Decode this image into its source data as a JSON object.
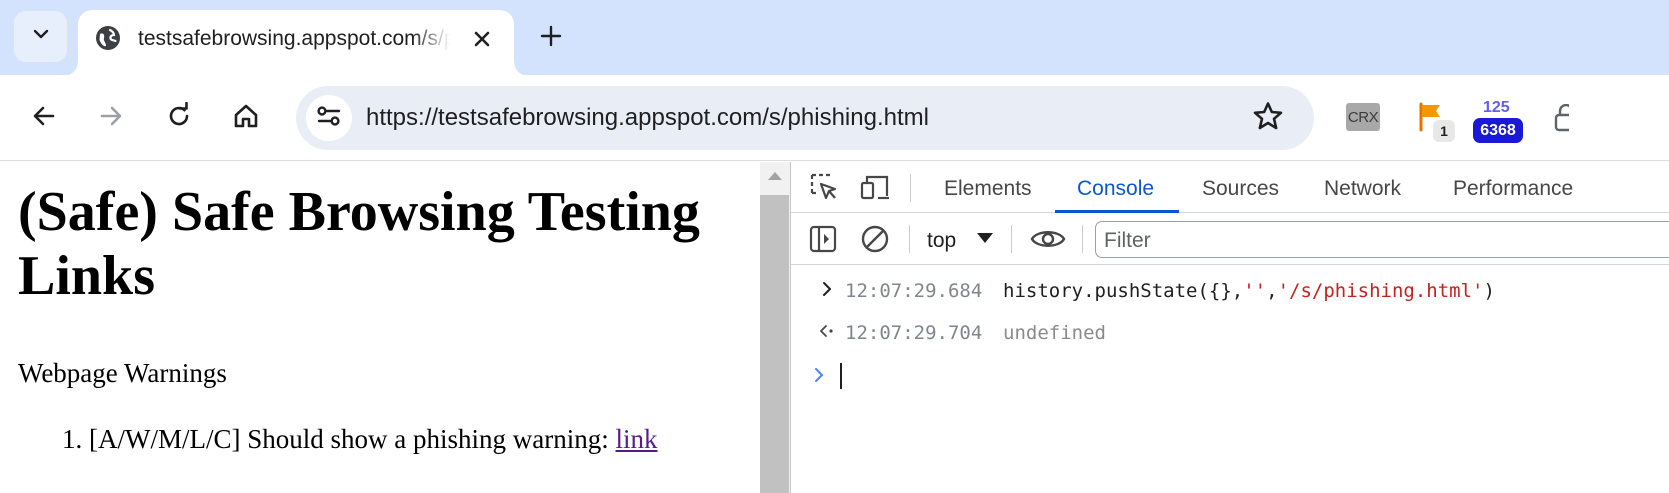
{
  "tab": {
    "title": "testsafebrowsing.appspot.com/s/phishing.html"
  },
  "toolbar": {
    "url": "https://testsafebrowsing.appspot.com/s/phishing.html"
  },
  "extensions": {
    "crx_label": "CRX",
    "flag_badge": "1",
    "counter_top": "125",
    "counter_badge": "6368"
  },
  "page": {
    "heading": "(Safe) Safe Browsing Testing Links",
    "section": "Webpage Warnings",
    "item_number": "1.",
    "item_text": "[A/W/M/L/C] Should show a phishing warning:",
    "item_link": "link"
  },
  "devtools": {
    "tabs": [
      "Elements",
      "Console",
      "Sources",
      "Network",
      "Performance"
    ],
    "active_tab": "Console",
    "context": "top",
    "filter_placeholder": "Filter",
    "console": [
      {
        "kind": "input",
        "timestamp": "12:07:29.684",
        "code_plain": "history.pushState({},",
        "code_str1": "''",
        "code_comma": ",",
        "code_str2": "'/s/phishing.html'",
        "code_close": ")"
      },
      {
        "kind": "result",
        "timestamp": "12:07:29.704",
        "value": "undefined"
      }
    ]
  },
  "colors": {
    "tabstrip_bg": "#d3e3fd",
    "omnibox_bg": "#e9eef6",
    "devtools_accent": "#0b57d0",
    "console_string": "#c5221f",
    "visited_link": "#551a8b",
    "counter_badge_bg": "#1a1ad6"
  }
}
